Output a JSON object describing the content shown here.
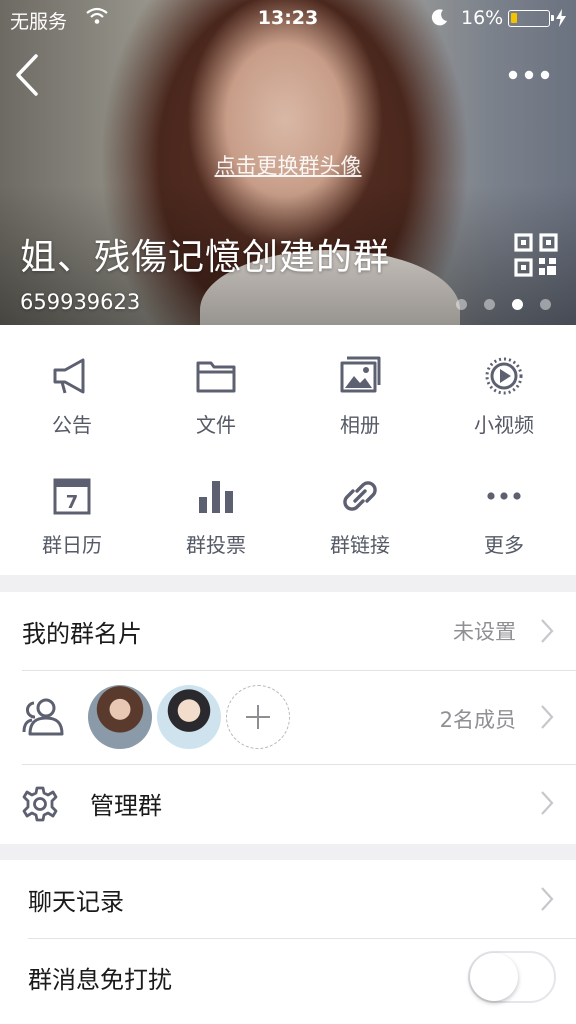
{
  "status_bar": {
    "carrier": "无服务",
    "time": "13:23",
    "battery_percent": "16%",
    "battery_level": 0.16,
    "icons": [
      "wifi-icon",
      "moon-icon",
      "battery-icon",
      "charging-bolt-icon"
    ]
  },
  "header": {
    "change_avatar_label": "点击更换群头像",
    "group_name": "姐、残傷记憶创建的群",
    "group_id": "659939623",
    "page_dots": {
      "count": 4,
      "active_index": 2
    },
    "icons": [
      "back-icon",
      "more-icon",
      "qr-code-icon"
    ]
  },
  "features": [
    {
      "label": "公告",
      "icon": "megaphone-icon"
    },
    {
      "label": "文件",
      "icon": "folder-icon"
    },
    {
      "label": "相册",
      "icon": "photo-album-icon"
    },
    {
      "label": "小视频",
      "icon": "video-play-icon"
    },
    {
      "label": "群日历",
      "icon": "calendar-icon"
    },
    {
      "label": "群投票",
      "icon": "bar-chart-icon"
    },
    {
      "label": "群链接",
      "icon": "link-icon"
    },
    {
      "label": "更多",
      "icon": "ellipsis-icon"
    }
  ],
  "calendar_day": "7",
  "settings": {
    "card_title": "我的群名片",
    "card_value": "未设置",
    "members_count": "2名成员",
    "manage_title": "管理群",
    "chat_history_title": "聊天记录",
    "mute_title": "群消息免打扰",
    "mute_on": false
  },
  "colors": {
    "icon_gray": "#5c6070",
    "chevron": "#c7c7cc",
    "battery_fill": "#f6c200",
    "page_bg": "#f0f0f2"
  }
}
